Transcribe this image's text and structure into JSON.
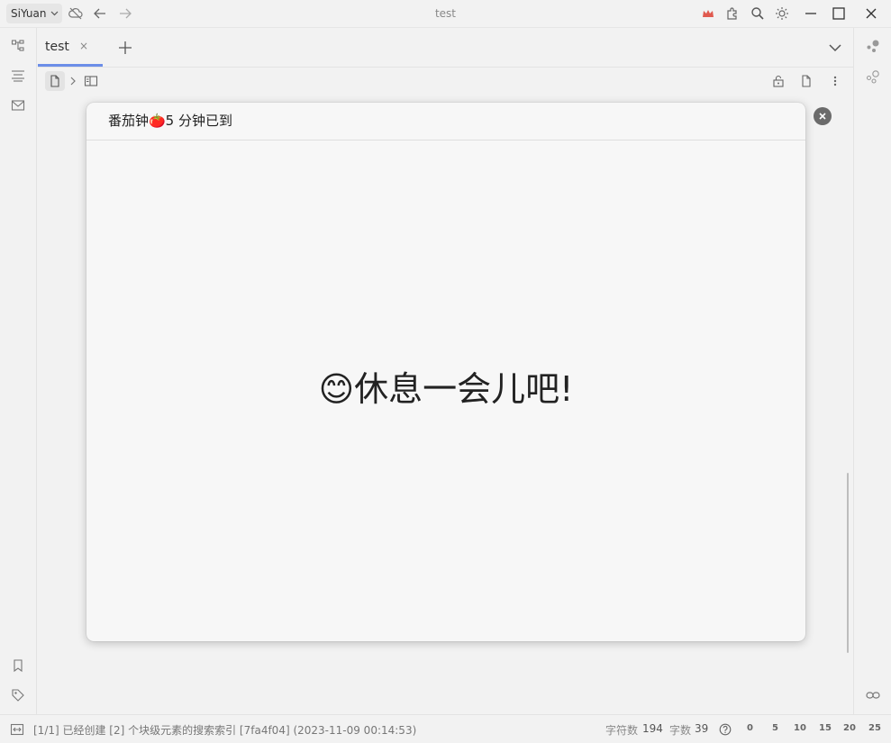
{
  "titlebar": {
    "workspace": "SiYuan",
    "title": "test"
  },
  "tabs": [
    {
      "label": "test",
      "close": "×"
    }
  ],
  "dialog": {
    "title": "番茄钟🍅5 分钟已到",
    "message": "😊休息一会儿吧!"
  },
  "statusbar": {
    "message": "[1/1] 已经创建 [2] 个块级元素的搜索索引 [7fa4f04] (2023-11-09 00:14:53)",
    "char_label": "字符数",
    "char_count": "194",
    "word_label": "字数",
    "word_count": "39",
    "zoom_marks": [
      "0",
      "5",
      "10",
      "15",
      "20",
      "25"
    ]
  },
  "colors": {
    "accent": "#6c8ee8",
    "crown": "#e05a4f"
  },
  "icons": [
    "cloud-off-icon",
    "back-icon",
    "forward-icon",
    "crown-icon",
    "plugin-icon",
    "search-icon",
    "theme-icon",
    "minimize-icon",
    "maximize-icon",
    "close-icon",
    "file-tree-icon",
    "outline-icon",
    "inbox-icon",
    "bookmark-icon",
    "tag-icon",
    "graph-icon",
    "global-graph-icon",
    "backlink-icon",
    "plus-icon",
    "chevron-down-icon",
    "doc-icon",
    "readonly-icon",
    "more-icon",
    "help-icon",
    "layout-icon"
  ]
}
